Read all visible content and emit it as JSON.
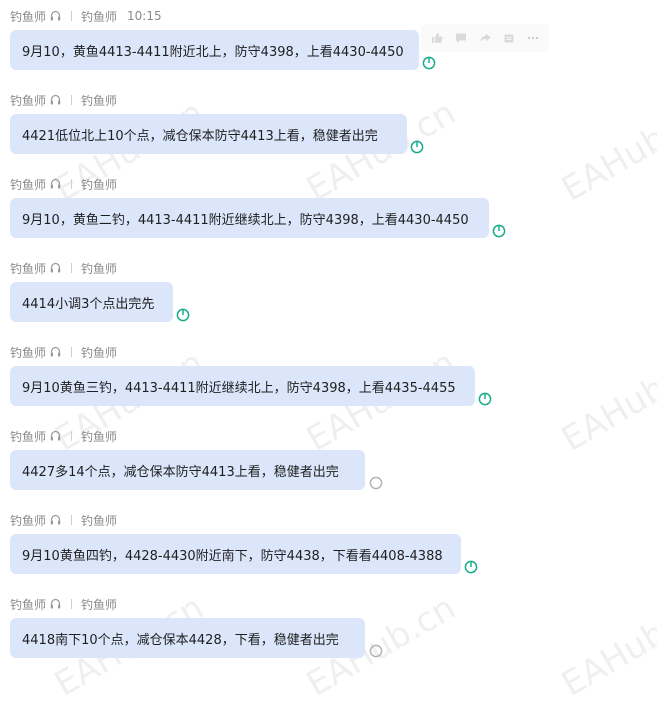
{
  "watermarks": {
    "site": "EAHub.cn",
    "brand": "EAHub"
  },
  "colors": {
    "bubble": "#dbe6fb",
    "read_status": "#1aad8c",
    "unread_status": "#b5b5b5",
    "meta_text": "#8a8a8a"
  },
  "toolbar": {
    "actions": [
      "thumbs-up-icon",
      "comment-icon",
      "forward-icon",
      "copy-icon",
      "more-icon"
    ]
  },
  "messages": [
    {
      "sender": "钓鱼师",
      "receiver": "钓鱼师",
      "time": "10:15",
      "text": "9月10，黄鱼4413-4411附近北上，防守4398，上看4430-4450",
      "status": "read"
    },
    {
      "sender": "钓鱼师",
      "receiver": "钓鱼师",
      "text": "4421低位北上10个点，减仓保本防守4413上看，稳健者出完",
      "status": "read"
    },
    {
      "sender": "钓鱼师",
      "receiver": "钓鱼师",
      "text": "9月10，黄鱼二钓，4413-4411附近继续北上，防守4398，上看4430-4450",
      "status": "read"
    },
    {
      "sender": "钓鱼师",
      "receiver": "钓鱼师",
      "text": "4414小调3个点出完先",
      "status": "read"
    },
    {
      "sender": "钓鱼师",
      "receiver": "钓鱼师",
      "text": "9月10黄鱼三钓，4413-4411附近继续北上，防守4398，上看4435-4455",
      "status": "read"
    },
    {
      "sender": "钓鱼师",
      "receiver": "钓鱼师",
      "text": "4427多14个点，减仓保本防守4413上看，稳健者出完",
      "status": "unread"
    },
    {
      "sender": "钓鱼师",
      "receiver": "钓鱼师",
      "text": "9月10黄鱼四钓，4428-4430附近南下，防守4438，下看看4408-4388",
      "status": "read"
    },
    {
      "sender": "钓鱼师",
      "receiver": "钓鱼师",
      "text": "4418南下10个点，减仓保本4428，下看，稳健者出完",
      "status": "unread"
    }
  ]
}
